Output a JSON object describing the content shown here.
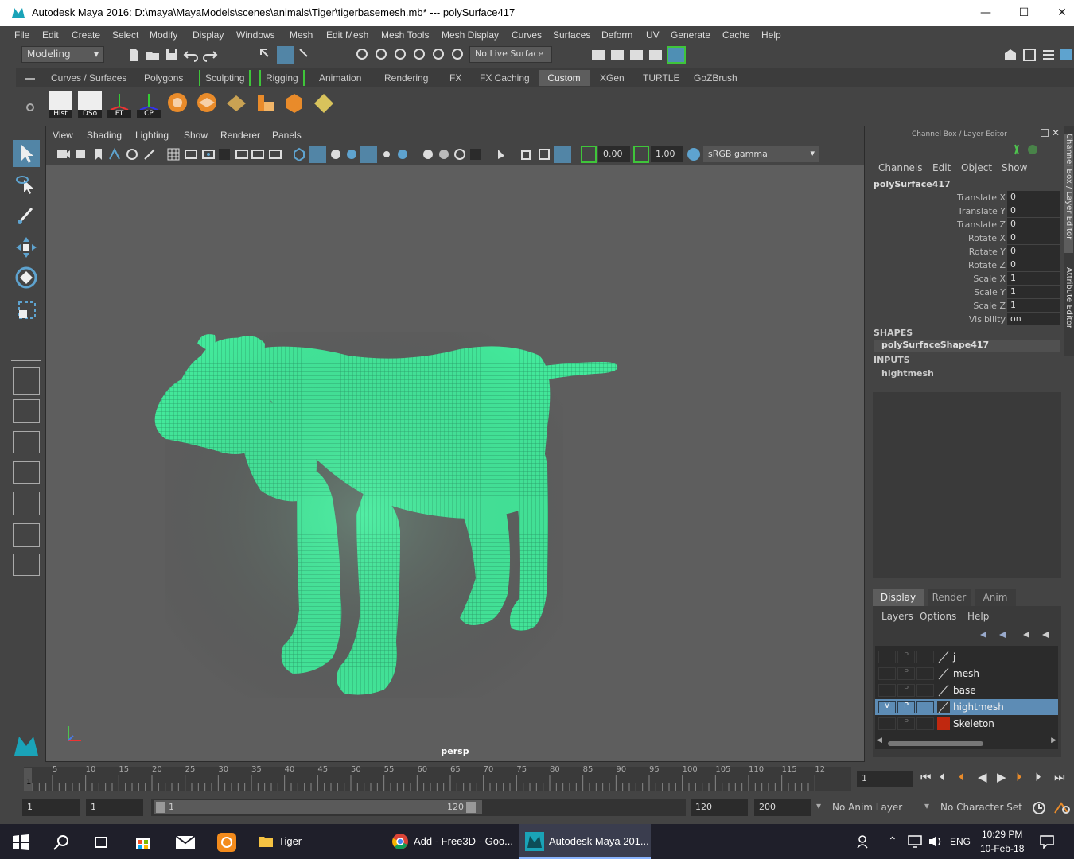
{
  "window": {
    "title": "Autodesk Maya 2016: D:\\maya\\MayaModels\\scenes\\animals\\Tiger\\tigerbasemesh.mb*   ---   polySurface417",
    "controls": [
      "—",
      "☐",
      "✕"
    ]
  },
  "menubar": [
    "File",
    "Edit",
    "Create",
    "Select",
    "Modify",
    "Display",
    "Windows",
    "Mesh",
    "Edit Mesh",
    "Mesh Tools",
    "Mesh Display",
    "Curves",
    "Surfaces",
    "Deform",
    "UV",
    "Generate",
    "Cache",
    "Help"
  ],
  "statusline": {
    "mode": "Modeling",
    "live_surface": "No Live Surface"
  },
  "shelf": {
    "tabs": [
      "Curves / Surfaces",
      "Polygons",
      "Sculpting",
      "Rigging",
      "Animation",
      "Rendering",
      "FX",
      "FX Caching",
      "Custom",
      "XGen",
      "TURTLE",
      "GoZBrush"
    ],
    "active_tab": "Custom",
    "buttons": [
      "Hist",
      "DSo",
      "FT",
      "CP"
    ]
  },
  "viewport": {
    "menu": [
      "View",
      "Shading",
      "Lighting",
      "Show",
      "Renderer",
      "Panels"
    ],
    "exposure": "0.00",
    "gamma": "1.00",
    "color_space": "sRGB gamma",
    "camera": "persp",
    "mesh_color": "#45f0a0"
  },
  "channelbox": {
    "header": "Channel Box / Layer Editor",
    "menu": [
      "Channels",
      "Edit",
      "Object",
      "Show"
    ],
    "object": "polySurface417",
    "attributes": [
      {
        "name": "Translate X",
        "value": "0"
      },
      {
        "name": "Translate Y",
        "value": "0"
      },
      {
        "name": "Translate Z",
        "value": "0"
      },
      {
        "name": "Rotate X",
        "value": "0"
      },
      {
        "name": "Rotate Y",
        "value": "0"
      },
      {
        "name": "Rotate Z",
        "value": "0"
      },
      {
        "name": "Scale X",
        "value": "1"
      },
      {
        "name": "Scale Y",
        "value": "1"
      },
      {
        "name": "Scale Z",
        "value": "1"
      },
      {
        "name": "Visibility",
        "value": "on"
      }
    ],
    "shapes_label": "SHAPES",
    "shape": "polySurfaceShape417",
    "inputs_label": "INPUTS",
    "input": "hightmesh"
  },
  "layer_editor": {
    "tabs": [
      "Display",
      "Render",
      "Anim"
    ],
    "active_tab": "Display",
    "menu": [
      "Layers",
      "Options",
      "Help"
    ],
    "layers": [
      {
        "name": "j",
        "v": "",
        "p": "P",
        "color": "",
        "active": false
      },
      {
        "name": "mesh",
        "v": "",
        "p": "P",
        "color": "",
        "active": false
      },
      {
        "name": "base",
        "v": "",
        "p": "P",
        "color": "",
        "active": false
      },
      {
        "name": "hightmesh",
        "v": "V",
        "p": "P",
        "color": "",
        "active": true
      },
      {
        "name": "Skeleton",
        "v": "",
        "p": "P",
        "color": "#c0280f",
        "active": false
      }
    ]
  },
  "side_tabs": [
    "Channel Box / Layer Editor",
    "Attribute Editor"
  ],
  "timeline": {
    "ticks": [
      "5",
      "10",
      "15",
      "20",
      "25",
      "30",
      "35",
      "40",
      "45",
      "50",
      "55",
      "60",
      "65",
      "70",
      "75",
      "80",
      "85",
      "90",
      "95",
      "100",
      "105",
      "110",
      "115",
      "12"
    ],
    "current_marker": "1",
    "current_frame": "1"
  },
  "range": {
    "start": "1",
    "playback_start": "1",
    "slider_start": "1",
    "slider_end": "120",
    "playback_end": "120",
    "end": "200",
    "anim_layer": "No Anim Layer",
    "char_set": "No Character Set"
  },
  "taskbar": {
    "tasks": [
      {
        "title": "Tiger"
      },
      {
        "title": "Add - Free3D - Goo..."
      },
      {
        "title": "Autodesk Maya 201..."
      }
    ],
    "lang": "ENG",
    "time": "10:29 PM",
    "date": "10-Feb-18"
  }
}
